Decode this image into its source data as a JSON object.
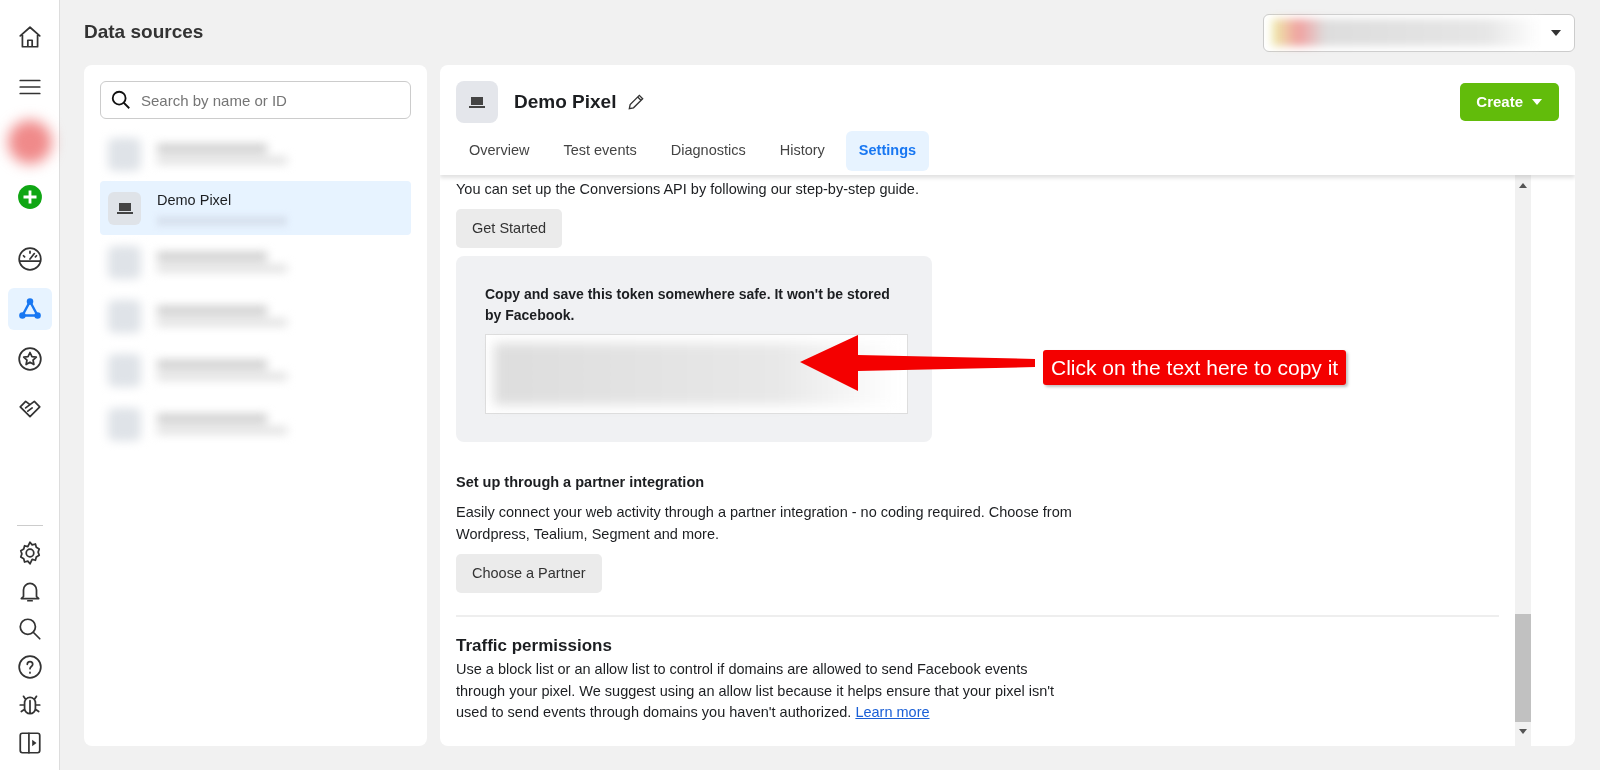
{
  "rail": {
    "items": [
      {
        "selected": false
      },
      {
        "selected": false
      },
      {
        "selected": false
      },
      {
        "selected": false
      },
      {
        "selected": false
      },
      {
        "selected": true
      },
      {
        "selected": false
      },
      {
        "selected": false
      }
    ]
  },
  "page_title": "Data sources",
  "search": {
    "placeholder": "Search by name or ID"
  },
  "sources": [
    {
      "kind": "redacted",
      "selected": false
    },
    {
      "kind": "pixel",
      "name": "Demo Pixel",
      "selected": true
    },
    {
      "kind": "redacted",
      "selected": false
    },
    {
      "kind": "redacted",
      "selected": false
    },
    {
      "kind": "redacted",
      "selected": false
    },
    {
      "kind": "redacted",
      "selected": false
    }
  ],
  "pixel": {
    "name": "Demo Pixel",
    "create_button": "Create",
    "tabs": [
      {
        "label": "Overview",
        "selected": false
      },
      {
        "label": "Test events",
        "selected": false
      },
      {
        "label": "Diagnostics",
        "selected": false
      },
      {
        "label": "History",
        "selected": false
      },
      {
        "label": "Settings",
        "selected": true
      }
    ]
  },
  "settings": {
    "intro": "You can set up the Conversions API by following our step-by-step guide.",
    "get_started_button": "Get Started",
    "token_note": "Copy and save this token somewhere safe. It won't be stored by Facebook.",
    "callout": "Click on the text here to copy it",
    "partner_heading": "Set up through a partner integration",
    "partner_text": "Easily connect your web activity through a partner integration - no coding required. Choose from Wordpress, Tealium, Segment and more.",
    "partner_button": "Choose a Partner",
    "traffic_heading": "Traffic permissions",
    "traffic_text": "Use a block list or an allow list to control if domains are allowed to send Facebook events through your pixel. We suggest using an allow list because it helps ensure that your pixel isn't used to send events through domains you haven't authorized.",
    "traffic_link": "Learn more"
  }
}
